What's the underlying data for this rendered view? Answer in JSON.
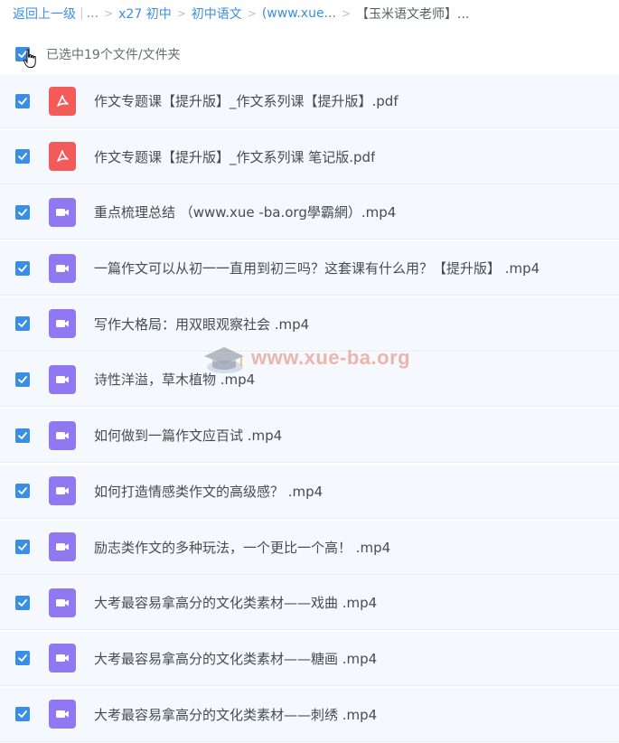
{
  "breadcrumb": {
    "back_label": "返回上一级",
    "bar": "|",
    "dots": "...",
    "sep": ">",
    "items": [
      "x27 初中",
      "初中语文",
      "(www.xue..."
    ],
    "current": "【玉米语文老师】..."
  },
  "selection": {
    "text": "已选中19个文件/文件夹"
  },
  "colors": {
    "accent": "#3a8ee6",
    "pdf_icon": "#f35a5a",
    "video_icon": "#8f78f0"
  },
  "files": [
    {
      "type": "pdf",
      "icon": "pdf-icon",
      "name": "作文专题课【提升版】_作文系列课【提升版】.pdf"
    },
    {
      "type": "pdf",
      "icon": "pdf-icon",
      "name": "作文专题课【提升版】_作文系列课 笔记版.pdf"
    },
    {
      "type": "mp4",
      "icon": "video-icon",
      "name": "重点梳理总结 （www.xue -ba.org學霸網）.mp4"
    },
    {
      "type": "mp4",
      "icon": "video-icon",
      "name": "一篇作文可以从初一一直用到初三吗？这套课有什么用？【提升版】 .mp4"
    },
    {
      "type": "mp4",
      "icon": "video-icon",
      "name": "写作大格局：用双眼观察社会 .mp4"
    },
    {
      "type": "mp4",
      "icon": "video-icon",
      "name": "诗性洋溢，草木植物 .mp4"
    },
    {
      "type": "mp4",
      "icon": "video-icon",
      "name": "如何做到一篇作文应百试 .mp4"
    },
    {
      "type": "mp4",
      "icon": "video-icon",
      "name": "如何打造情感类作文的高级感？ .mp4"
    },
    {
      "type": "mp4",
      "icon": "video-icon",
      "name": "励志类作文的多种玩法，一个更比一个高！ .mp4"
    },
    {
      "type": "mp4",
      "icon": "video-icon",
      "name": "大考最容易拿高分的文化类素材——戏曲 .mp4"
    },
    {
      "type": "mp4",
      "icon": "video-icon",
      "name": "大考最容易拿高分的文化类素材——糖画 .mp4"
    },
    {
      "type": "mp4",
      "icon": "video-icon",
      "name": "大考最容易拿高分的文化类素材——刺绣 .mp4"
    }
  ],
  "watermark": {
    "text": "www.xue-ba.org"
  }
}
